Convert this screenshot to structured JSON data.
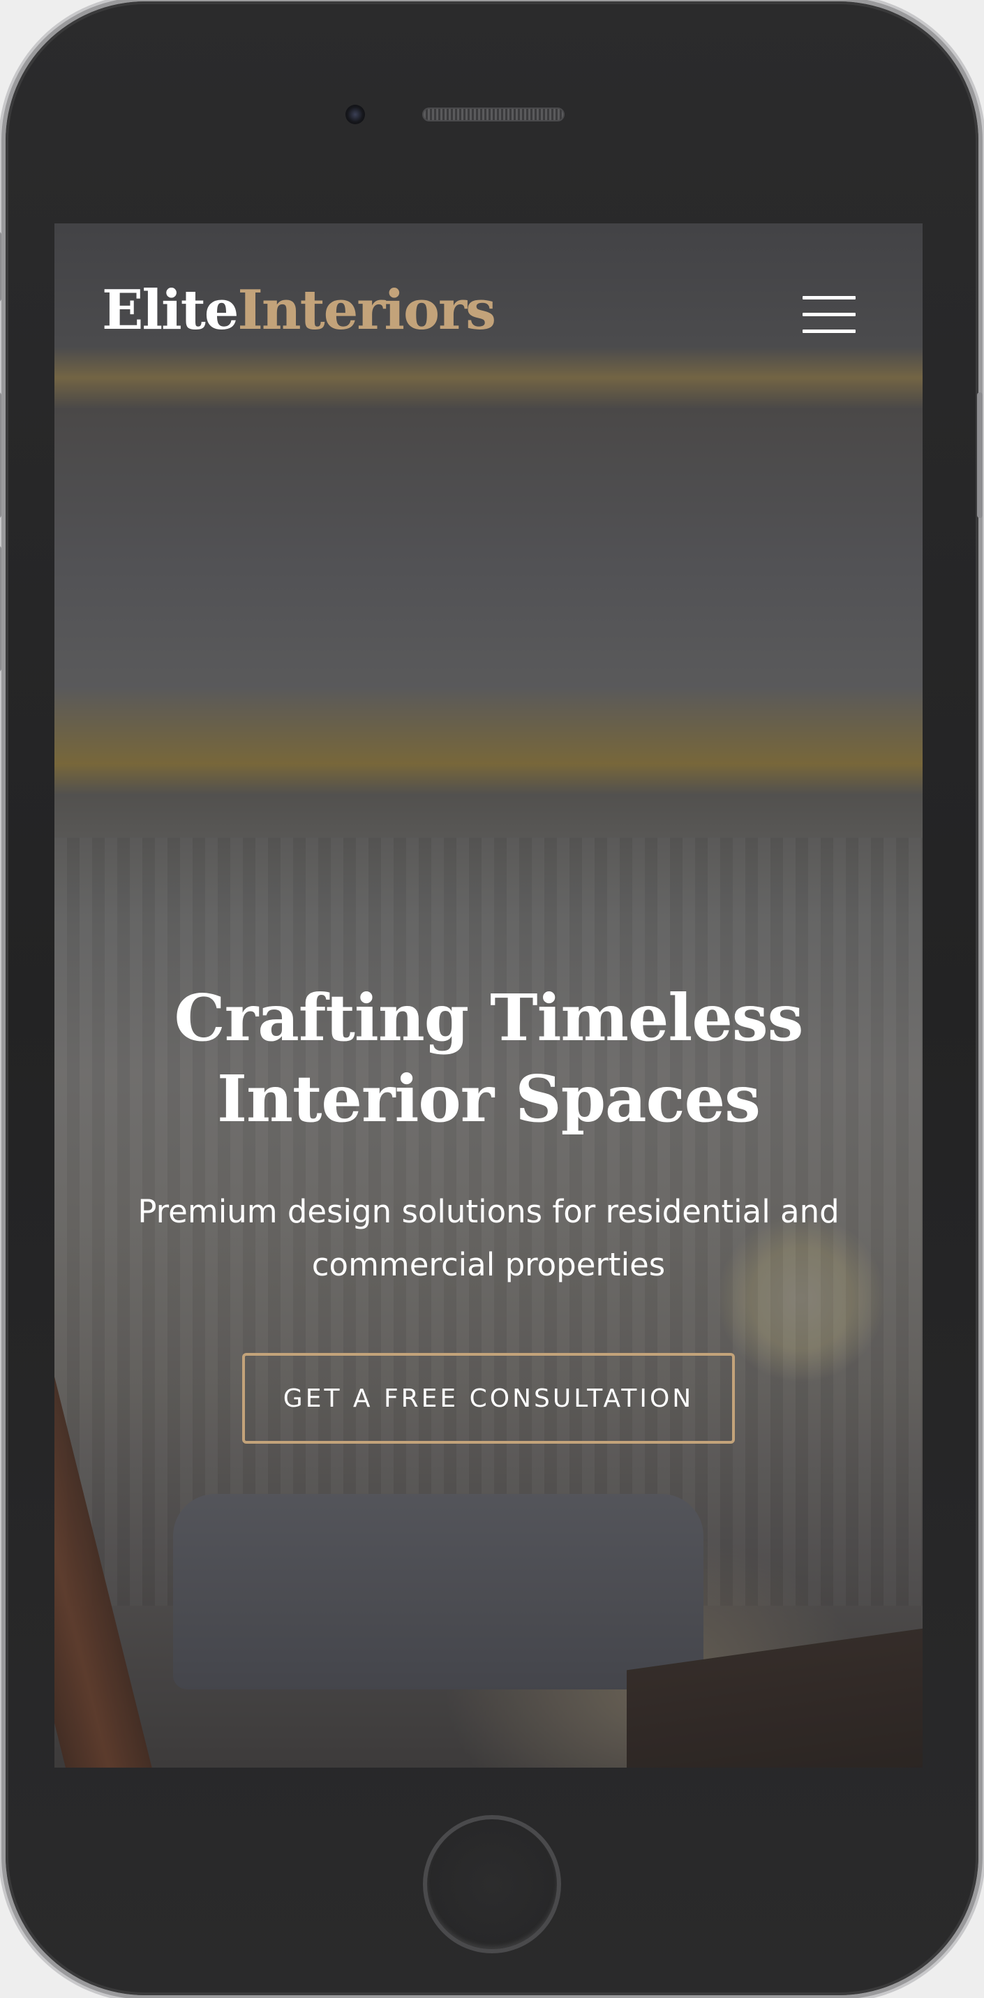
{
  "header": {
    "logo_part1": "Elite",
    "logo_part2": "Interiors",
    "menu_icon": "hamburger-menu-icon"
  },
  "hero": {
    "title": "Crafting Timeless Interior Spaces",
    "subtitle": "Premium design solutions for residential and commercial properties",
    "cta_label": "GET A FREE CONSULTATION"
  },
  "colors": {
    "accent": "#c3a37a",
    "text": "#ffffff",
    "device_body": "#252526"
  }
}
